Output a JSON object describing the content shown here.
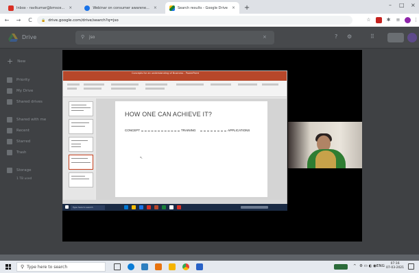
{
  "browser": {
    "tabs": [
      {
        "label": "Inbox - ravikumar@bmsce...",
        "icon_color": "#d93025",
        "active": false
      },
      {
        "label": "Webinar on consumer awarene...",
        "icon_color": "#1a73e8",
        "active": false
      },
      {
        "label": "Search results - Google Drive",
        "icon_color": "#188038",
        "active": true
      }
    ],
    "new_tab": "+",
    "controls": {
      "minimize": "–",
      "maximize": "□",
      "close": "×"
    },
    "url": "drive.google.com/drive/search?q=jso",
    "nav": {
      "back": "←",
      "forward": "→",
      "reload": "C"
    }
  },
  "drive": {
    "title": "Drive",
    "search_query": "jso",
    "new_button": "New",
    "sidebar": [
      "Priority",
      "My Drive",
      "Shared drives",
      "Shared with me",
      "Recent",
      "Starred",
      "Trash",
      "Storage"
    ],
    "storage_text": "1 TB used"
  },
  "viewer": {
    "powerpoint": {
      "window_title": "Concepts for an understanding of Business - PowerPoint",
      "slide": {
        "title": "HOW ONE CAN ACHIEVE IT?",
        "steps": [
          "CONCEPT",
          "TRAINING",
          "APPLICATIONS"
        ]
      }
    },
    "inner_taskbar_search": "Type here to search"
  },
  "taskbar": {
    "search_placeholder": "Type here to search",
    "tray_lang": "ENG",
    "time": "07:16",
    "date": "07-03-2021"
  },
  "colors": {
    "powerpoint_accent": "#b7472a",
    "drive_dim": "#3f4144",
    "taskbar": "#e5e9ef"
  }
}
